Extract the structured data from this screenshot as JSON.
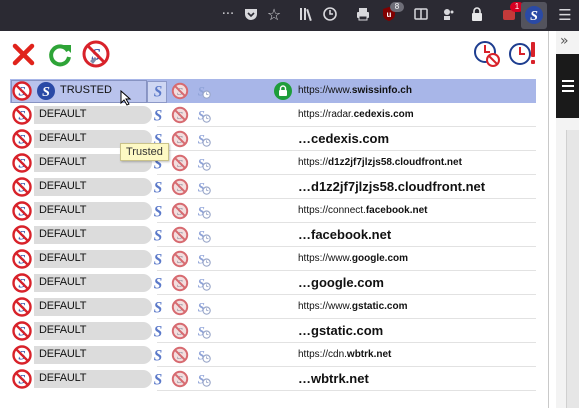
{
  "browser_toolbar": {
    "icons": [
      "more-dots-icon",
      "pocket-icon",
      "bookmark-star-icon",
      "library-icon",
      "history-icon",
      "print-icon",
      "ublock-icon",
      "reader-view-icon",
      "extension-icon",
      "lock-extension-icon",
      "notification-extension-icon",
      "noscript-toolbar-icon",
      "firefox-menu-icon"
    ],
    "ublock_badge": "8",
    "notification_badge": "1",
    "overflow_chevron": "»",
    "colors": {
      "ublock_badge": "#6e6e78",
      "notification_badge": "#d70022"
    }
  },
  "popup": {
    "header_buttons": [
      {
        "name": "close-button",
        "icon": "red-x-icon"
      },
      {
        "name": "reload-button",
        "icon": "green-reload-icon"
      },
      {
        "name": "options-button",
        "icon": "noscript-options-icon"
      },
      {
        "name": "revoke-temp-button",
        "icon": "clock-forbid-icon"
      },
      {
        "name": "temp-trust-all-button",
        "icon": "clock-alert-icon"
      }
    ],
    "tooltip": "Trusted",
    "rows": [
      {
        "status": "TRUSTED",
        "url_prefix": "https://www.",
        "url_domain": "swissinfo.ch",
        "size": "small",
        "selected": true,
        "https_lock": true
      },
      {
        "status": "DEFAULT",
        "url_prefix": "https://radar.",
        "url_domain": "cedexis.com",
        "size": "small"
      },
      {
        "status": "DEFAULT",
        "url_prefix": "…",
        "url_domain": "cedexis.com",
        "size": "big"
      },
      {
        "status": "DEFAULT",
        "url_prefix": "https://",
        "url_domain": "d1z2jf7jlzjs58.cloudfront.net",
        "size": "small"
      },
      {
        "status": "DEFAULT",
        "url_prefix": "…",
        "url_domain": "d1z2jf7jlzjs58.cloudfront.net",
        "size": "big"
      },
      {
        "status": "DEFAULT",
        "url_prefix": "https://connect.",
        "url_domain": "facebook.net",
        "size": "small"
      },
      {
        "status": "DEFAULT",
        "url_prefix": "…",
        "url_domain": "facebook.net",
        "size": "big"
      },
      {
        "status": "DEFAULT",
        "url_prefix": "https://www.",
        "url_domain": "google.com",
        "size": "small"
      },
      {
        "status": "DEFAULT",
        "url_prefix": "…",
        "url_domain": "google.com",
        "size": "big"
      },
      {
        "status": "DEFAULT",
        "url_prefix": "https://www.",
        "url_domain": "gstatic.com",
        "size": "small"
      },
      {
        "status": "DEFAULT",
        "url_prefix": "…",
        "url_domain": "gstatic.com",
        "size": "big"
      },
      {
        "status": "DEFAULT",
        "url_prefix": "https://cdn.",
        "url_domain": "wbtrk.net",
        "size": "small"
      },
      {
        "status": "DEFAULT",
        "url_prefix": "…",
        "url_domain": "wbtrk.net",
        "size": "big"
      }
    ],
    "colors": {
      "selected_row": "#a8b6e8",
      "default_pill": "#dcdcdc",
      "forbid_red": "#d8222a",
      "noscript_blue": "#2a4aa6",
      "https_green": "#1e9d3a"
    }
  }
}
